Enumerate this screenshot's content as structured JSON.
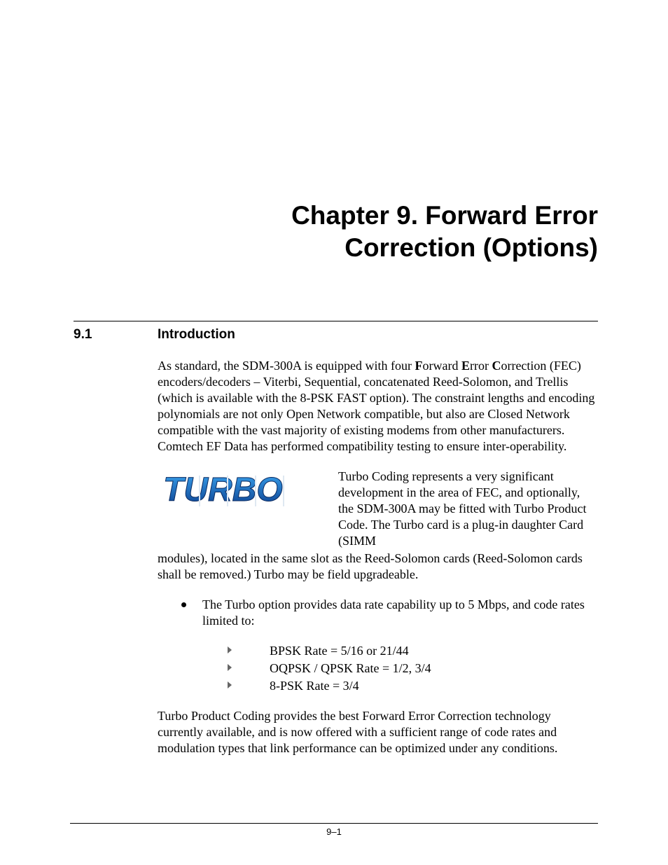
{
  "chapter_title_l1": "Chapter 9. Forward Error",
  "chapter_title_l2": "Correction (Options)",
  "section": {
    "num": "9.1",
    "title": "Introduction"
  },
  "p1a": "As standard, the SDM-300A is equipped with four ",
  "p1_F": "F",
  "p1_F2": "orward ",
  "p1_E": "E",
  "p1_E2": "rror ",
  "p1_C": "C",
  "p1_C2": "orrection (FEC) encoders/decoders – Viterbi, Sequential, concatenated Reed-Solomon, and Trellis (which is available with the 8-PSK FAST option). The constraint lengths and encoding polynomials are not only Open Network compatible, but also are Closed Network compatible with the vast majority of existing modems from other manufacturers. Comtech EF Data has performed compatibility testing to ensure inter-operability.",
  "turbo_side": "Turbo Coding represents a very significant development in the area of FEC, and optionally, the SDM-300A may be fitted with Turbo Product Code. The Turbo card is a plug-in daughter Card (SIMM",
  "turbo_cont": "modules), located in the same slot as the Reed-Solomon cards (Reed-Solomon cards shall be removed.)  Turbo may be field upgradeable.",
  "bullet1": "The Turbo option provides data rate capability up to 5 Mbps, and code rates limited to:",
  "sub1": "BPSK Rate = 5/16 or 21/44",
  "sub2": "OQPSK / QPSK Rate = 1/2, 3/4",
  "sub3": "8-PSK Rate = 3/4",
  "p_last": "Turbo Product Coding provides the best Forward Error Correction technology currently available, and is now offered with a sufficient range of code rates and modulation types that link performance can be optimized under any conditions.",
  "page_num": "9–1",
  "logo_text": "TURBO"
}
